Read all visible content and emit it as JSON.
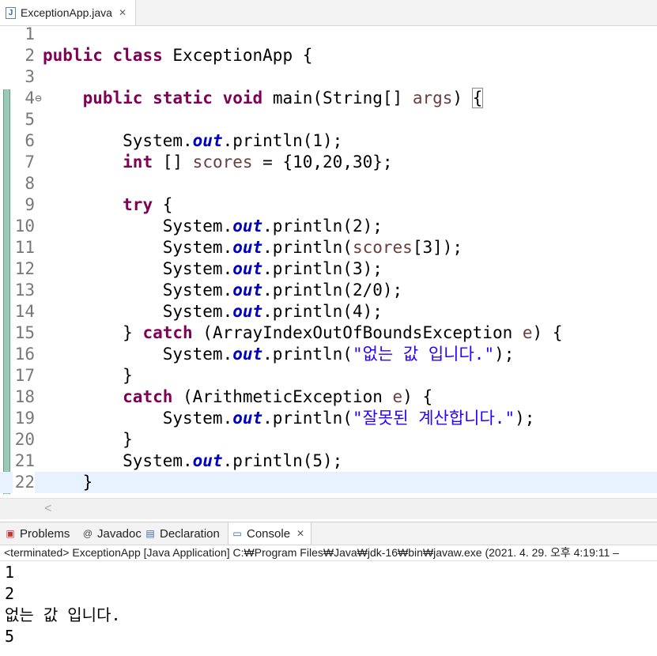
{
  "editor_tab": {
    "title": "ExceptionApp.java",
    "close": "✕"
  },
  "code_lines": [
    {
      "num": "1",
      "parts": []
    },
    {
      "num": "2",
      "parts": [
        [
          "kw",
          "public"
        ],
        [
          "t",
          " "
        ],
        [
          "kw",
          "class"
        ],
        [
          "t",
          " ExceptionApp {"
        ]
      ]
    },
    {
      "num": "3",
      "parts": []
    },
    {
      "num": "4",
      "parts": [
        [
          "t",
          "    "
        ],
        [
          "kw",
          "public"
        ],
        [
          "t",
          " "
        ],
        [
          "kw",
          "static"
        ],
        [
          "t",
          " "
        ],
        [
          "kw",
          "void"
        ],
        [
          "t",
          " main(String[] "
        ],
        [
          "var",
          "args"
        ],
        [
          "t",
          ") "
        ],
        [
          "brace",
          "{"
        ]
      ]
    },
    {
      "num": "5",
      "parts": []
    },
    {
      "num": "6",
      "parts": [
        [
          "t",
          "        System."
        ],
        [
          "fld",
          "out"
        ],
        [
          "t",
          ".println(1);"
        ]
      ]
    },
    {
      "num": "7",
      "parts": [
        [
          "t",
          "        "
        ],
        [
          "kw",
          "int"
        ],
        [
          "t",
          " [] "
        ],
        [
          "var",
          "scores"
        ],
        [
          "t",
          " = {10,20,30};"
        ]
      ]
    },
    {
      "num": "8",
      "parts": []
    },
    {
      "num": "9",
      "parts": [
        [
          "t",
          "        "
        ],
        [
          "kw",
          "try"
        ],
        [
          "t",
          " {"
        ]
      ]
    },
    {
      "num": "10",
      "parts": [
        [
          "t",
          "            System."
        ],
        [
          "fld",
          "out"
        ],
        [
          "t",
          ".println(2);"
        ]
      ]
    },
    {
      "num": "11",
      "parts": [
        [
          "t",
          "            System."
        ],
        [
          "fld",
          "out"
        ],
        [
          "t",
          ".println("
        ],
        [
          "var",
          "scores"
        ],
        [
          "t",
          "[3]);"
        ]
      ]
    },
    {
      "num": "12",
      "parts": [
        [
          "t",
          "            System."
        ],
        [
          "fld",
          "out"
        ],
        [
          "t",
          ".println(3);"
        ]
      ]
    },
    {
      "num": "13",
      "parts": [
        [
          "t",
          "            System."
        ],
        [
          "fld",
          "out"
        ],
        [
          "t",
          ".println(2/0);"
        ]
      ]
    },
    {
      "num": "14",
      "parts": [
        [
          "t",
          "            System."
        ],
        [
          "fld",
          "out"
        ],
        [
          "t",
          ".println(4);"
        ]
      ]
    },
    {
      "num": "15",
      "parts": [
        [
          "t",
          "        } "
        ],
        [
          "kw",
          "catch"
        ],
        [
          "t",
          " (ArrayIndexOutOfBoundsException "
        ],
        [
          "var",
          "e"
        ],
        [
          "t",
          ") {"
        ]
      ]
    },
    {
      "num": "16",
      "parts": [
        [
          "t",
          "            System."
        ],
        [
          "fld",
          "out"
        ],
        [
          "t",
          ".println("
        ],
        [
          "str",
          "\"없는 값 입니다.\""
        ],
        [
          "t",
          ");"
        ]
      ]
    },
    {
      "num": "17",
      "parts": [
        [
          "t",
          "        }"
        ]
      ]
    },
    {
      "num": "18",
      "parts": [
        [
          "t",
          "        "
        ],
        [
          "kw",
          "catch"
        ],
        [
          "t",
          " (ArithmeticException "
        ],
        [
          "var",
          "e"
        ],
        [
          "t",
          ") {"
        ]
      ]
    },
    {
      "num": "19",
      "parts": [
        [
          "t",
          "            System."
        ],
        [
          "fld",
          "out"
        ],
        [
          "t",
          ".println("
        ],
        [
          "str",
          "\"잘못된 계산합니다.\""
        ],
        [
          "t",
          ");"
        ]
      ]
    },
    {
      "num": "20",
      "parts": [
        [
          "t",
          "        }"
        ]
      ]
    },
    {
      "num": "21",
      "parts": [
        [
          "t",
          "        System."
        ],
        [
          "fld",
          "out"
        ],
        [
          "t",
          ".println(5);"
        ]
      ]
    },
    {
      "num": "22",
      "parts": [
        [
          "t",
          "    }"
        ]
      ]
    }
  ],
  "panel_tabs": {
    "problems": "Problems",
    "javadoc": "Javadoc",
    "declaration": "Declaration",
    "console": "Console",
    "console_close": "✕"
  },
  "console_header": "<terminated> ExceptionApp [Java Application] C:₩Program Files₩Java₩jdk-16₩bin₩javaw.exe  (2021. 4. 29. 오후 4:19:11 –",
  "console_output": [
    "1",
    "2",
    "없는 값 입니다.",
    "5"
  ]
}
